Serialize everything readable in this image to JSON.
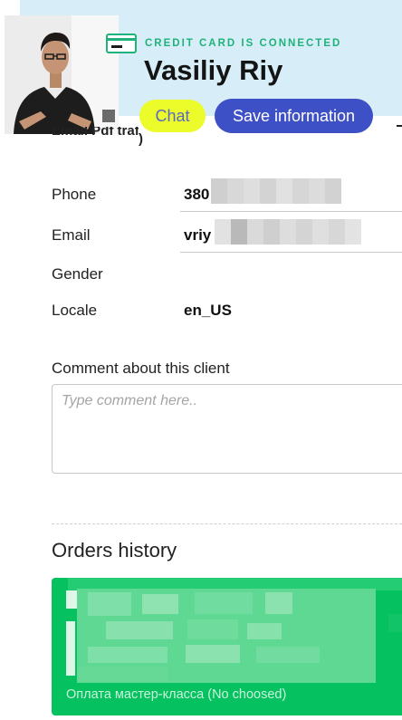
{
  "header": {
    "card_status": "CREDIT CARD IS CONNECTED",
    "client_name": "Vasiliy Riy",
    "chat_label": "Chat",
    "save_label": "Save information"
  },
  "partial_label": {
    "text": "Email Pdf traffic",
    "tail": ")"
  },
  "details": {
    "phone": {
      "label": "Phone",
      "value_prefix": "380"
    },
    "email": {
      "label": "Email",
      "value_prefix": "vriy"
    },
    "gender": {
      "label": "Gender",
      "value": ""
    },
    "locale": {
      "label": "Locale",
      "value": "en_US"
    }
  },
  "comment": {
    "label": "Comment about this client",
    "placeholder": "Type comment here..",
    "value": ""
  },
  "orders": {
    "title": "Orders history",
    "items": [
      {
        "product": "Оплата мастер-класса (No choosed)"
      }
    ]
  },
  "colors": {
    "header_bg": "#d7eef8",
    "chat_button_bg": "#ecfb2a",
    "save_button_bg": "#3e50c6",
    "card_status_text": "#1fb27a",
    "order_card_bg": "#05c160"
  },
  "icons": {
    "card": "credit-card-icon",
    "avatar": "user-photo"
  }
}
